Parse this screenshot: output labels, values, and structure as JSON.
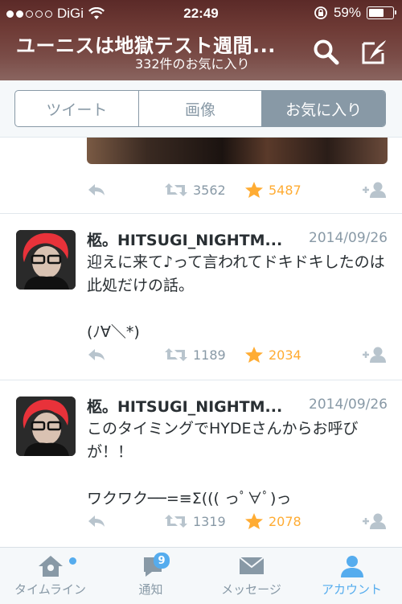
{
  "status_bar": {
    "carrier": "DiGi",
    "time": "22:49",
    "battery": "59%",
    "battery_level": 0.59
  },
  "header": {
    "title": "ユーニスは地獄テスト週間...",
    "subtitle": "332件のお気に入り"
  },
  "segments": [
    "ツイート",
    "画像",
    "お気に入り"
  ],
  "first_actions": {
    "retweets": "3562",
    "favorites": "5487"
  },
  "tweets": [
    {
      "name": "柩。HITSUGI_NIGHTM...",
      "date": "2014/09/26",
      "text": "迎えに来て♪って言われてドキドキしたのは此処だけの話。\n\n(ﾉ∀＼*)",
      "retweets": "1189",
      "favorites": "2034"
    },
    {
      "name": "柩。HITSUGI_NIGHTM...",
      "date": "2014/09/26",
      "text": "このタイミングでHYDEさんからお呼びが！！\n\nワクワク──=≡Σ((( っﾟ∀ﾟ)っ",
      "retweets": "1319",
      "favorites": "2078"
    }
  ],
  "tabbar": {
    "home": "タイムライン",
    "notifications": "通知",
    "notifications_badge": "9",
    "messages": "メッセージ",
    "account": "アカウント"
  },
  "colors": {
    "accent": "#55acee",
    "favorite": "#ffac33",
    "muted": "#8899a6"
  }
}
